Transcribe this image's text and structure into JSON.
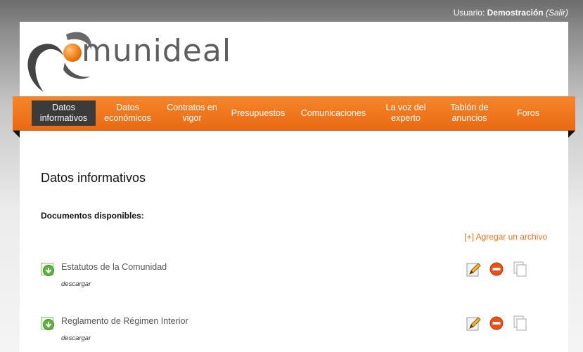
{
  "user_bar": {
    "label": "Usuario:",
    "name": "Demostración",
    "logout": "(Salir)"
  },
  "logo": {
    "text": "munideal"
  },
  "nav": {
    "items": [
      {
        "label": "Datos informativos"
      },
      {
        "label": "Datos económicos"
      },
      {
        "label": "Contratos en vigor"
      },
      {
        "label": "Presupuestos"
      },
      {
        "label": "Comunicaciones"
      },
      {
        "label": "La voz del experto"
      },
      {
        "label": "Tablón de anuncios"
      },
      {
        "label": "Foros"
      }
    ]
  },
  "page": {
    "title": "Datos informativos",
    "documents_heading": "Documentos disponibles:",
    "add_file": "[+] Agregar un archivo"
  },
  "documents": [
    {
      "title": "Estatutos de la Comunidad",
      "download": "descargar"
    },
    {
      "title": "Reglamento de Régimen Interior",
      "download": "descargar"
    }
  ],
  "icons": {
    "doc": "green-document-icon",
    "edit": "edit-pencil-icon",
    "delete": "delete-icon",
    "copy": "copy-document-icon"
  },
  "colors": {
    "accent": "#f07b12",
    "active_tab": "#3b3b3b",
    "link": "#e8731b"
  }
}
